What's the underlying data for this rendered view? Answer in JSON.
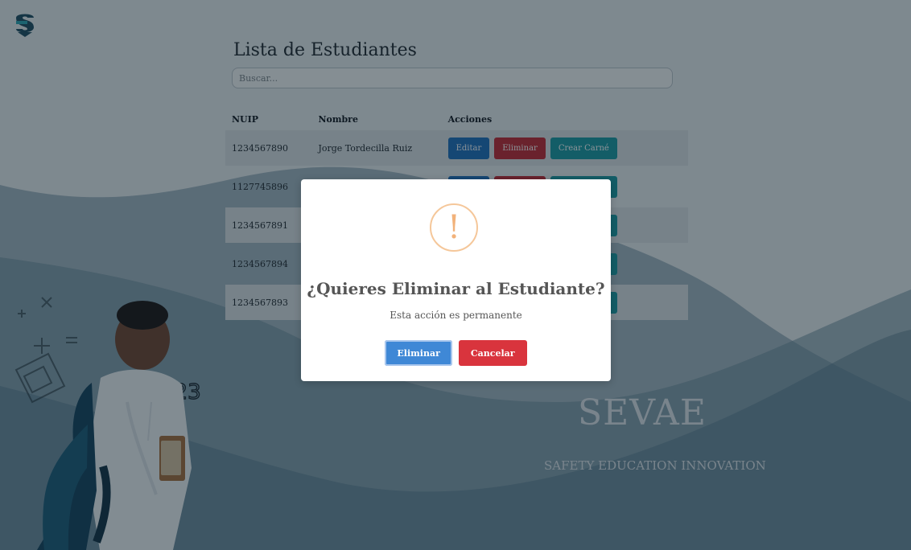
{
  "page": {
    "title": "Lista de Estudiantes",
    "search": {
      "placeholder": "Buscar...",
      "value": ""
    },
    "table": {
      "headers": [
        "NUIP",
        "Nombre",
        "Acciones"
      ],
      "rows": [
        {
          "nuip": "1234567890",
          "nombre": "Jorge Tordecilla Ruiz"
        },
        {
          "nuip": "1127745896",
          "nombre": ""
        },
        {
          "nuip": "1234567891",
          "nombre": ""
        },
        {
          "nuip": "1234567894",
          "nombre": ""
        },
        {
          "nuip": "1234567893",
          "nombre": ""
        }
      ],
      "actions": {
        "edit": "Editar",
        "delete": "Eliminar",
        "card": "Crear Carné"
      }
    },
    "branding": {
      "name": "SEVAE",
      "tagline": "SAFETY EDUCATION INNOVATION"
    },
    "decorations": {
      "numbers": "123"
    }
  },
  "modal": {
    "icon": "warning-icon",
    "title": "¿Quieres Eliminar al Estudiante?",
    "text": "Esta acción es permanente",
    "confirm": "Eliminar",
    "cancel": "Cancelar"
  },
  "colors": {
    "primary": "#1d6fbd",
    "danger": "#c02a34",
    "teal": "#1a9aa4",
    "warning": "#f2b27a"
  }
}
